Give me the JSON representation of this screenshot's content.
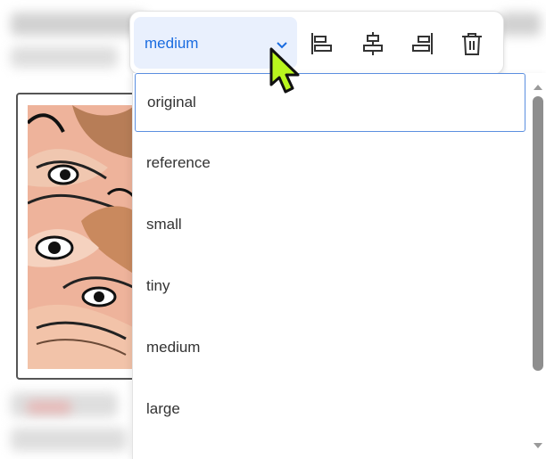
{
  "toolbar": {
    "size_select": {
      "value": "medium"
    },
    "buttons": [
      {
        "name": "align-left",
        "icon": "align-left-icon"
      },
      {
        "name": "align-center",
        "icon": "align-center-icon"
      },
      {
        "name": "align-right",
        "icon": "align-right-icon"
      },
      {
        "name": "delete",
        "icon": "trash-icon"
      }
    ]
  },
  "dropdown": {
    "options": [
      "original",
      "reference",
      "small",
      "tiny",
      "medium",
      "large"
    ],
    "highlighted": "original"
  },
  "colors": {
    "accent": "#1a6ce0",
    "select_bg": "#e9f0fd",
    "highlight_border": "#5b8fe0",
    "cursor_fill": "#b9f61e"
  }
}
